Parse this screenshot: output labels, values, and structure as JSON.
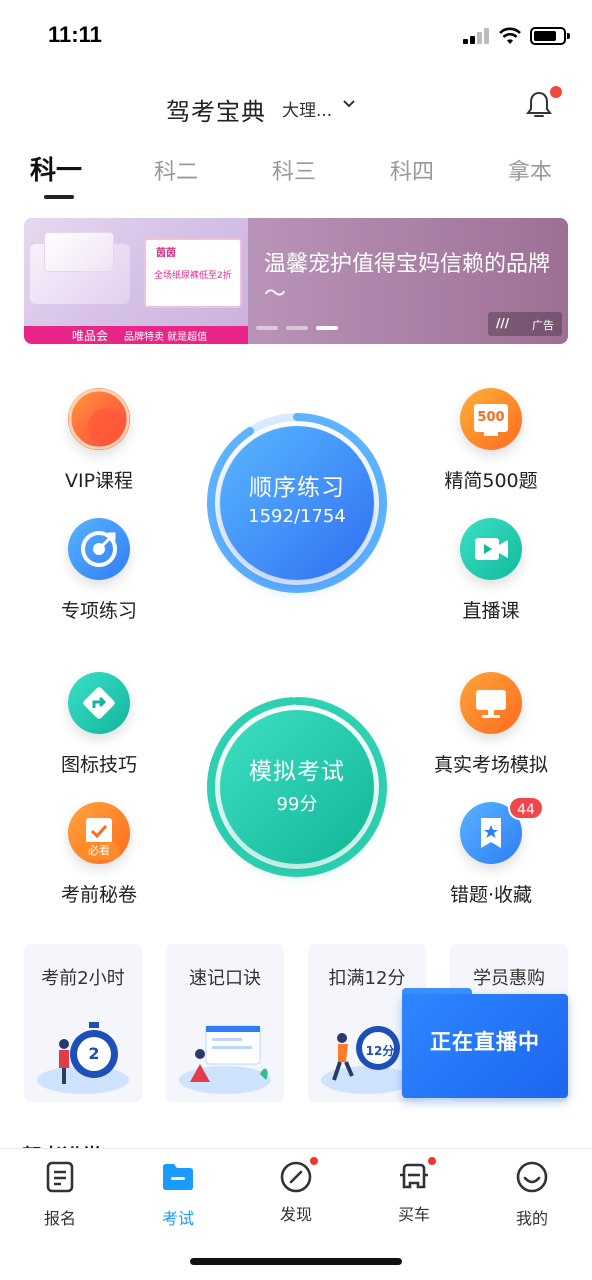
{
  "status_bar": {
    "time": "11:11"
  },
  "header": {
    "title": "驾考宝典",
    "city": "大理..."
  },
  "tabs": [
    {
      "label": "科一",
      "active": true
    },
    {
      "label": "科二",
      "active": false
    },
    {
      "label": "科三",
      "active": false
    },
    {
      "label": "科四",
      "active": false
    },
    {
      "label": "拿本",
      "active": false
    }
  ],
  "banner": {
    "headline": "温馨宠护值得宝妈信赖的品牌～",
    "brand": "唯品会",
    "brand_tagline": "品牌特卖 就是超值",
    "product_logo": "茵茵",
    "product_promo": "全场纸尿裤低至2折",
    "ad_label": "广告",
    "slides_total": 3,
    "slide_active": 3
  },
  "features": {
    "vip": "VIP课程",
    "special": "专项练习",
    "jingjian": "精简500题",
    "jingjian_icon_text": "500",
    "live": "直播课",
    "sign": "图标技巧",
    "real_exam": "真实考场模拟",
    "secret": "考前秘卷",
    "secret_tag": "必看",
    "mistakes": "错题·收藏",
    "mistakes_badge": "44"
  },
  "practice": {
    "title": "顺序练习",
    "progress": "1592/1754",
    "done": 1592,
    "total": 1754
  },
  "mock": {
    "title": "模拟考试",
    "score": "99分",
    "score_value": 99
  },
  "cards": [
    {
      "title": "考前2小时",
      "icon_text": "2"
    },
    {
      "title": "速记口诀"
    },
    {
      "title": "扣满12分",
      "icon_text": "12分"
    },
    {
      "title": "学员惠购"
    }
  ],
  "live_float": {
    "label": "正在直播中"
  },
  "section_peek": "驾考进堂",
  "bottom_nav": [
    {
      "label": "报名",
      "active": false,
      "dot": false
    },
    {
      "label": "考试",
      "active": true,
      "dot": false
    },
    {
      "label": "发现",
      "active": false,
      "dot": true
    },
    {
      "label": "买车",
      "active": false,
      "dot": true
    },
    {
      "label": "我的",
      "active": false,
      "dot": false
    }
  ],
  "colors": {
    "accent": "#1a9bff",
    "practice_blue": "#2f7df6",
    "mock_green": "#17c2a4",
    "badge_red": "#f0464c"
  }
}
